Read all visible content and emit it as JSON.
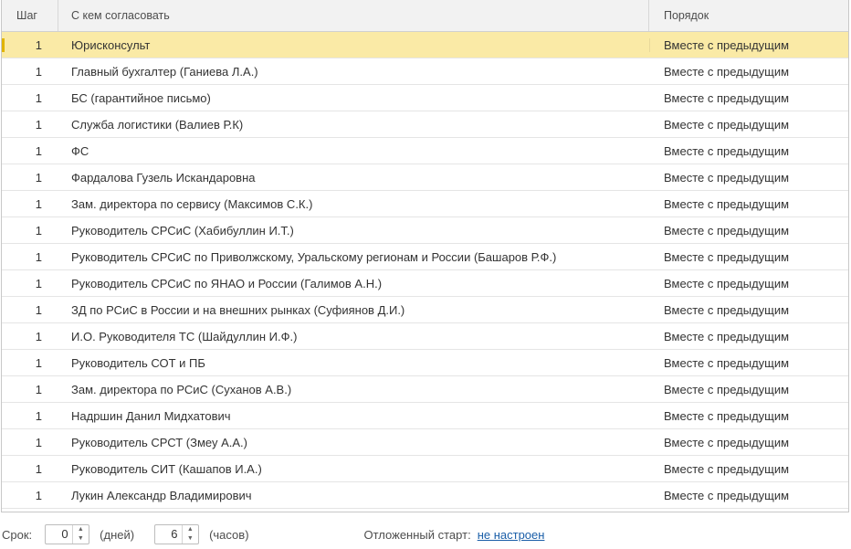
{
  "table": {
    "headers": {
      "step": "Шаг",
      "who": "С кем согласовать",
      "order": "Порядок"
    },
    "rows": [
      {
        "step": "1",
        "who": "Юрисконсульт",
        "order": "Вместе с предыдущим"
      },
      {
        "step": "1",
        "who": "Главный бухгалтер (Ганиева Л.А.)",
        "order": "Вместе с предыдущим"
      },
      {
        "step": "1",
        "who": "БС (гарантийное письмо)",
        "order": "Вместе с предыдущим"
      },
      {
        "step": "1",
        "who": "Служба логистики (Валиев Р.К)",
        "order": "Вместе с предыдущим"
      },
      {
        "step": "1",
        "who": "ФС",
        "order": "Вместе с предыдущим"
      },
      {
        "step": "1",
        "who": "Фардалова Гузель Искандаровна",
        "order": "Вместе с предыдущим"
      },
      {
        "step": "1",
        "who": "Зам. директора по сервису (Максимов С.К.)",
        "order": "Вместе с предыдущим"
      },
      {
        "step": "1",
        "who": "Руководитель СРСиС (Хабибуллин И.Т.)",
        "order": "Вместе с предыдущим"
      },
      {
        "step": "1",
        "who": "Руководитель СРСиС по Приволжскому, Уральскому регионам и России (Башаров Р.Ф.)",
        "order": "Вместе с предыдущим"
      },
      {
        "step": "1",
        "who": "Руководитель СРСиС по ЯНАО и России (Галимов А.Н.)",
        "order": "Вместе с предыдущим"
      },
      {
        "step": "1",
        "who": "ЗД по РСиС в России и на внешних рынках (Суфиянов Д.И.)",
        "order": "Вместе с предыдущим"
      },
      {
        "step": "1",
        "who": "И.О. Руководителя ТС (Шайдуллин И.Ф.)",
        "order": "Вместе с предыдущим"
      },
      {
        "step": "1",
        "who": "Руководитель СОТ и ПБ",
        "order": "Вместе с предыдущим"
      },
      {
        "step": "1",
        "who": "Зам. директора по РСиС (Суханов А.В.)",
        "order": "Вместе с предыдущим"
      },
      {
        "step": "1",
        "who": "Надршин Данил Мидхатович",
        "order": "Вместе с предыдущим"
      },
      {
        "step": "1",
        "who": "Руководитель СРСТ (Змеу А.А.)",
        "order": "Вместе с предыдущим"
      },
      {
        "step": "1",
        "who": "Руководитель СИТ (Кашапов И.А.)",
        "order": "Вместе с предыдущим"
      },
      {
        "step": "1",
        "who": "Лукин Александр Владимирович",
        "order": "Вместе с предыдущим"
      }
    ]
  },
  "footer": {
    "term_label": "Срок:",
    "days_value": "0",
    "days_label": "(дней)",
    "hours_value": "6",
    "hours_label": "(часов)",
    "delayed_start_label": "Отложенный старт:",
    "delayed_start_link": "не настроен"
  },
  "colors": {
    "selected_row": "#faeaa6",
    "link": "#1a5ea8"
  },
  "icons": {
    "spin_up": "triangle-up-icon",
    "spin_down": "triangle-down-icon"
  }
}
